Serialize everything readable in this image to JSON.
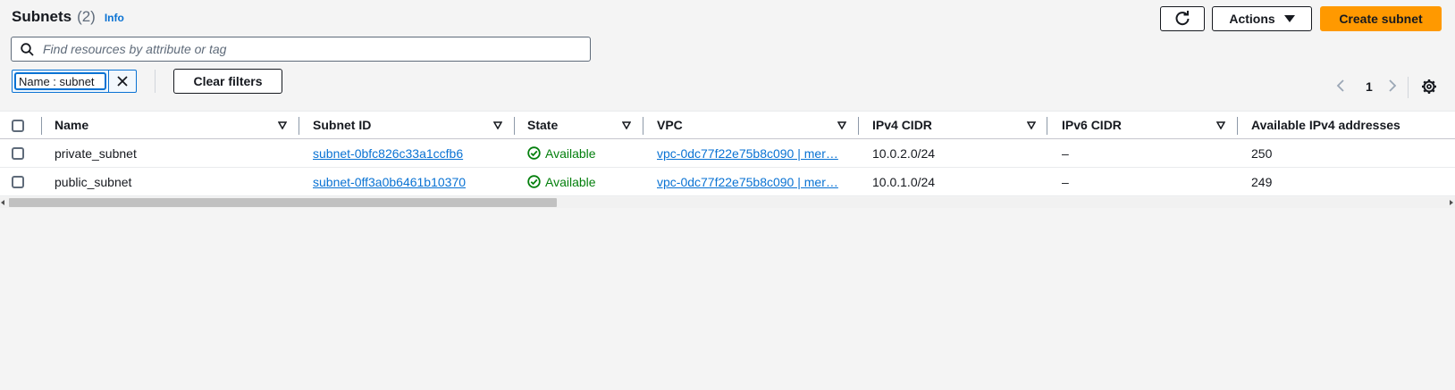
{
  "header": {
    "title": "Subnets",
    "count": "(2)",
    "info_link": "Info",
    "actions_label": "Actions",
    "create_label": "Create subnet"
  },
  "search": {
    "placeholder": "Find resources by attribute or tag",
    "value": ""
  },
  "filter": {
    "token_label": "Name : subnet",
    "clear_label": "Clear filters"
  },
  "pagination": {
    "current_page": "1"
  },
  "table": {
    "columns": [
      "Name",
      "Subnet ID",
      "State",
      "VPC",
      "IPv4 CIDR",
      "IPv6 CIDR",
      "Available IPv4 addresses"
    ],
    "rows": [
      {
        "name": "private_subnet",
        "subnet_id": "subnet-0bfc826c33a1ccfb6",
        "state": "Available",
        "vpc": "vpc-0dc77f22e75b8c090 | mer…",
        "ipv4_cidr": "10.0.2.0/24",
        "ipv6_cidr": "–",
        "available_ipv4": "250"
      },
      {
        "name": "public_subnet",
        "subnet_id": "subnet-0ff3a0b6461b10370",
        "state": "Available",
        "vpc": "vpc-0dc77f22e75b8c090 | mer…",
        "ipv4_cidr": "10.0.1.0/24",
        "ipv6_cidr": "–",
        "available_ipv4": "249"
      }
    ]
  },
  "colors": {
    "accent_link": "#0972d3",
    "primary_button": "#ff9900",
    "status_available": "#037f0c"
  },
  "icons": [
    "search-icon",
    "refresh-icon",
    "caret-down-icon",
    "close-icon",
    "chevron-left-icon",
    "chevron-right-icon",
    "gear-icon",
    "sort-icon",
    "status-available-icon"
  ]
}
